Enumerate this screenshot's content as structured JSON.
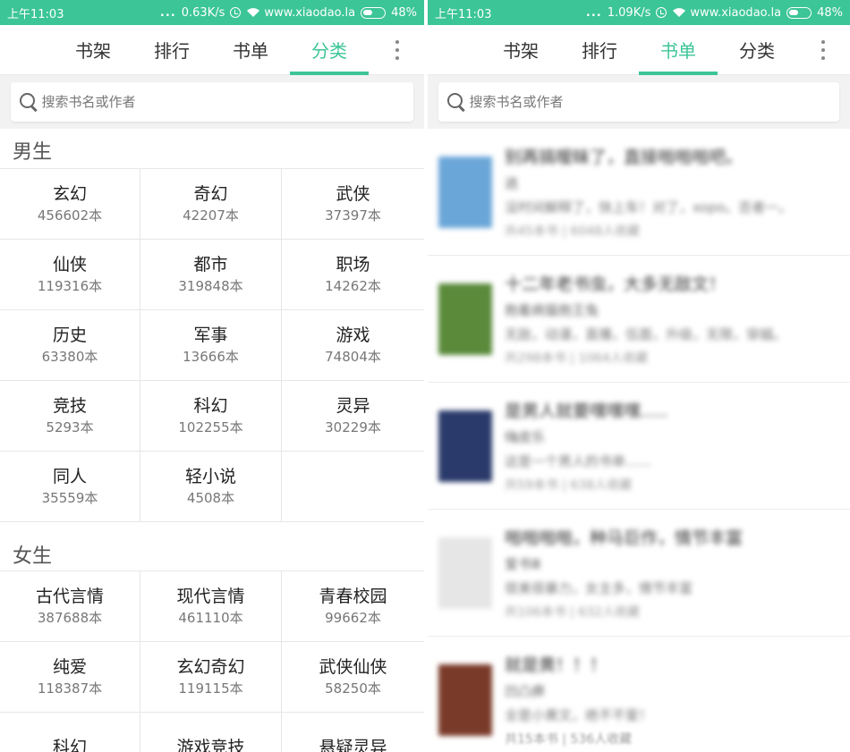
{
  "left": {
    "status": {
      "time": "上午11:03",
      "dots": "...",
      "speed": "0.63K/s",
      "site": "www.xiaodao.la",
      "battery": "48%"
    },
    "tabs": [
      {
        "label": "书架",
        "active": false
      },
      {
        "label": "排行",
        "active": false
      },
      {
        "label": "书单",
        "active": false
      },
      {
        "label": "分类",
        "active": true
      }
    ],
    "search": {
      "placeholder": "搜索书名或作者"
    },
    "male": {
      "title": "男生",
      "items": [
        {
          "name": "玄幻",
          "count": "456602本"
        },
        {
          "name": "奇幻",
          "count": "42207本"
        },
        {
          "name": "武侠",
          "count": "37397本"
        },
        {
          "name": "仙侠",
          "count": "119316本"
        },
        {
          "name": "都市",
          "count": "319848本"
        },
        {
          "name": "职场",
          "count": "14262本"
        },
        {
          "name": "历史",
          "count": "63380本"
        },
        {
          "name": "军事",
          "count": "13666本"
        },
        {
          "name": "游戏",
          "count": "74804本"
        },
        {
          "name": "竞技",
          "count": "5293本"
        },
        {
          "name": "科幻",
          "count": "102255本"
        },
        {
          "name": "灵异",
          "count": "30229本"
        },
        {
          "name": "同人",
          "count": "35559本"
        },
        {
          "name": "轻小说",
          "count": "4508本"
        }
      ]
    },
    "female": {
      "title": "女生",
      "items": [
        {
          "name": "古代言情",
          "count": "387688本"
        },
        {
          "name": "现代言情",
          "count": "461110本"
        },
        {
          "name": "青春校园",
          "count": "99662本"
        },
        {
          "name": "纯爱",
          "count": "118387本"
        },
        {
          "name": "玄幻奇幻",
          "count": "119115本"
        },
        {
          "name": "武侠仙侠",
          "count": "58250本"
        },
        {
          "name": "科幻",
          "count": ""
        },
        {
          "name": "游戏竞技",
          "count": ""
        },
        {
          "name": "悬疑灵异",
          "count": ""
        }
      ]
    }
  },
  "right": {
    "status": {
      "time": "上午11:03",
      "dots": "...",
      "speed": "1.09K/s",
      "site": "www.xiaodao.la",
      "battery": "48%"
    },
    "tabs": [
      {
        "label": "书架",
        "active": false
      },
      {
        "label": "排行",
        "active": false
      },
      {
        "label": "书单",
        "active": true
      },
      {
        "label": "分类",
        "active": false
      }
    ],
    "search": {
      "placeholder": "搜索书名或作者"
    },
    "books": [
      {
        "title": "别再搞暧昧了，直接啪啪啪吧。",
        "author": "逍",
        "desc": "没时间解释了，快上车！对了，xopo。否者一。",
        "stats": "共45本书 | 6048人收藏",
        "cover_color": "#6aa6d8"
      },
      {
        "title": "十二年老书虫，大多无敌文！",
        "author": "抱着病猫抱王兔",
        "desc": "无敌，动漫，直播，伍面，升级，无限，穿越。",
        "stats": "共298本书 | 1064人收藏",
        "cover_color": "#5a8a3a"
      },
      {
        "title": "是男人就要嘿嘿嘿.....",
        "author": "嗨皮乐",
        "desc": "这是一个男人的书单......",
        "stats": "共59本书 | 638人收藏",
        "cover_color": "#2a3a6a"
      },
      {
        "title": "啪啪啪啪，种马巨作，情节丰富",
        "author": "爱书Ⅲ",
        "desc": "很美很暴力，女主多，情节丰富",
        "stats": "共106本书 | 632人收藏",
        "cover_color": "#e6e6e6"
      },
      {
        "title": "就是黄！！！",
        "author": "凹凸痹",
        "desc": "全是小黄文，绝不不爱！",
        "stats": "共15本书 | 536人收藏",
        "cover_color": "#7a3a2a"
      }
    ]
  },
  "colors": {
    "accent": "#3cc596"
  }
}
